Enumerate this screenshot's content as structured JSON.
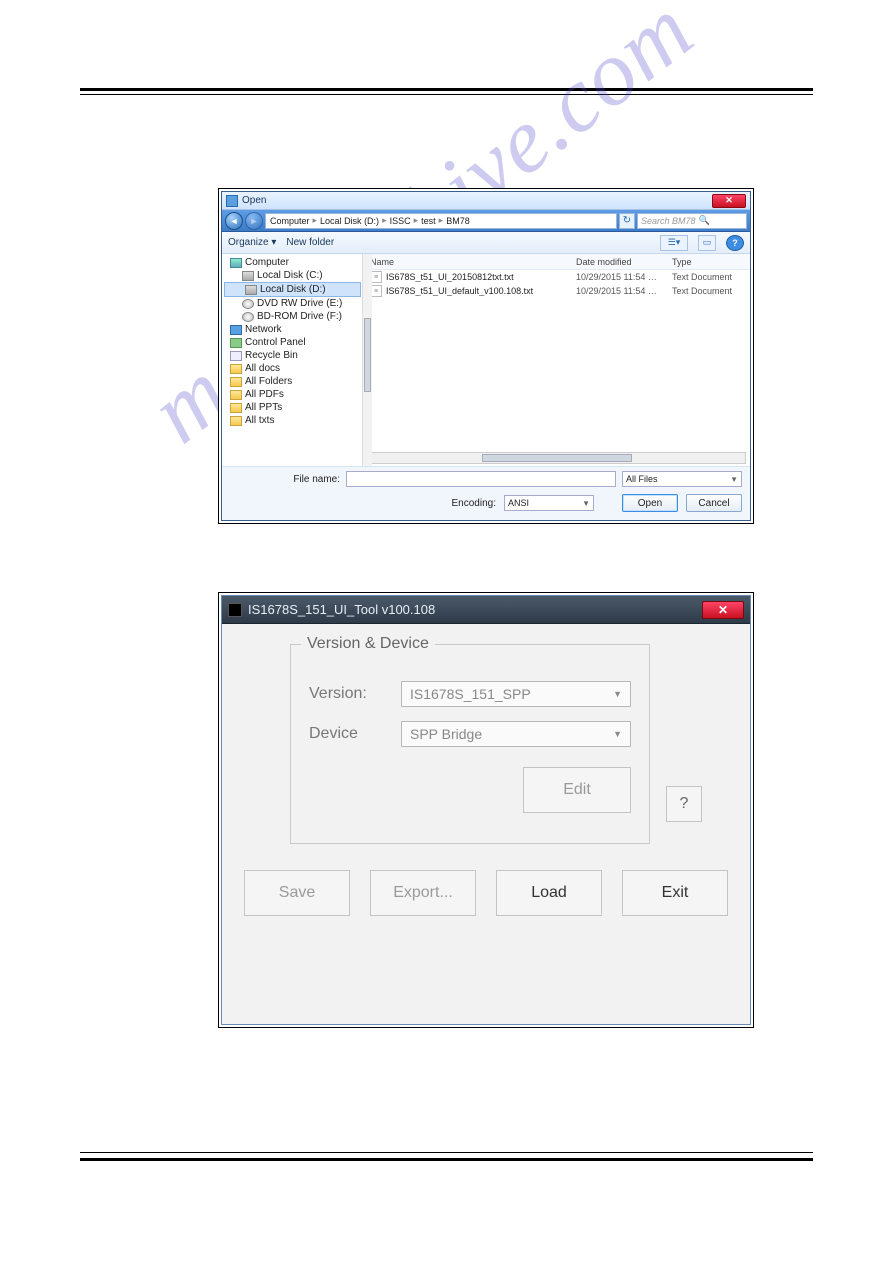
{
  "watermark_text": "manualshive.com",
  "dialog1": {
    "title": "Open",
    "breadcrumb": [
      "Computer",
      "Local Disk (D:)",
      "ISSC",
      "test",
      "BM78"
    ],
    "search_placeholder": "Search BM78",
    "toolbar": {
      "organize": "Organize ▾",
      "newfolder": "New folder"
    },
    "tree": [
      {
        "label": "Computer",
        "icon": "comp",
        "indent": 0
      },
      {
        "label": "Local Disk (C:)",
        "icon": "disk",
        "indent": 1
      },
      {
        "label": "Local Disk (D:)",
        "icon": "disk",
        "indent": 1,
        "selected": true
      },
      {
        "label": "DVD RW Drive (E:)",
        "icon": "dvd",
        "indent": 1
      },
      {
        "label": "BD-ROM Drive (F:)",
        "icon": "dvd",
        "indent": 1
      },
      {
        "label": "Network",
        "icon": "net",
        "indent": 0
      },
      {
        "label": "Control Panel",
        "icon": "cp",
        "indent": 0
      },
      {
        "label": "Recycle Bin",
        "icon": "bin",
        "indent": 0
      },
      {
        "label": "All docs",
        "icon": "fold",
        "indent": 0
      },
      {
        "label": "All Folders",
        "icon": "fold",
        "indent": 0
      },
      {
        "label": "All PDFs",
        "icon": "fold",
        "indent": 0
      },
      {
        "label": "All PPTs",
        "icon": "fold",
        "indent": 0
      },
      {
        "label": "All txts",
        "icon": "fold",
        "indent": 0
      }
    ],
    "columns": {
      "name": "Name",
      "date": "Date modified",
      "type": "Type"
    },
    "files": [
      {
        "name": "IS678S_t51_UI_20150812txt.txt",
        "date": "10/29/2015 11:54 …",
        "type": "Text Document"
      },
      {
        "name": "IS678S_t51_UI_default_v100.108.txt",
        "date": "10/29/2015 11:54 …",
        "type": "Text Document"
      }
    ],
    "footer": {
      "filename_label": "File name:",
      "filename_value": "",
      "filter_value": "All Files",
      "encoding_label": "Encoding:",
      "encoding_value": "ANSI",
      "open_label": "Open",
      "cancel_label": "Cancel"
    }
  },
  "dialog2": {
    "title": "IS1678S_151_UI_Tool v100.108",
    "group_legend": "Version & Device",
    "version_label": "Version:",
    "version_value": "IS1678S_151_SPP",
    "device_label": "Device",
    "device_value": "SPP Bridge",
    "edit_label": "Edit",
    "help_label": "?",
    "buttons": {
      "save": "Save",
      "export": "Export...",
      "load": "Load",
      "exit": "Exit"
    }
  }
}
